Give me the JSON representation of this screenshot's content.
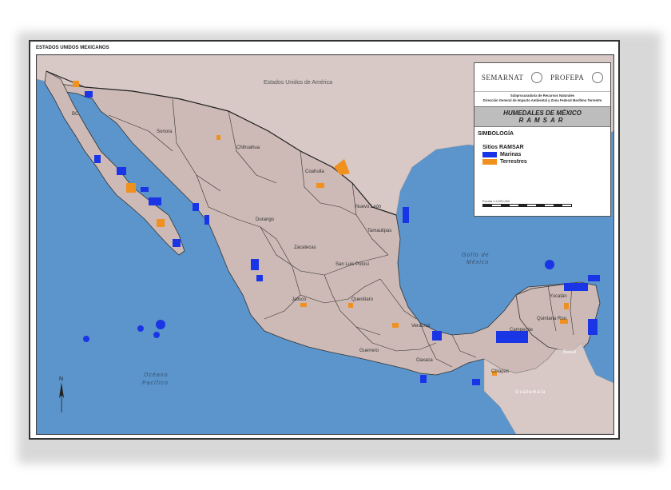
{
  "top_label": "ESTADOS UNIDOS MEXICANOS",
  "legend": {
    "logos": [
      "SEMARNAT",
      "PROFEPA"
    ],
    "subtitle_lines": [
      "Subprocuraduría de Recursos Naturales",
      "Dirección General de Impacto Ambiental y Zona Federal Marítimo Terrestre"
    ],
    "title_line1": "HUMEDALES DE MÉXICO",
    "title_line2": "RAMSAR",
    "simbologia": "SIMBOLOGÍA",
    "sitios": "Sitios RAMSAR",
    "items": [
      {
        "label": "Marinas",
        "color": "#1a35e6"
      },
      {
        "label": "Terrestres",
        "color": "#f0901e"
      }
    ],
    "scale": "Escala 1:4,000,000"
  },
  "labels": {
    "usa": "Estados Unidos de América",
    "gulf_line1": "Golfo de",
    "gulf_line2": "México",
    "pacific_line1": "Océano",
    "pacific_line2": "Pacífico",
    "belice": "Belice",
    "guatemala": "Guatemala",
    "north": "N",
    "states": {
      "bc": "BC",
      "sonora": "Sonora",
      "chihuahua": "Chihuahua",
      "coahuila": "Coahuila",
      "nuevo_leon": "Nuevo León",
      "tamaulipas": "Tamaulipas",
      "durango": "Durango",
      "zacatecas": "Zacatecas",
      "slp": "San Luis Potosí",
      "jalisco": "Jalisco",
      "queretaro": "Querétaro",
      "veracruz": "Veracruz",
      "guerrero": "Guerrero",
      "oaxaca": "Oaxaca",
      "chiapas": "Chiapas",
      "campeche": "Campeche",
      "yucatan": "Yucatán",
      "quintana_roo": "Quintana Roo"
    }
  },
  "colors": {
    "ocean": "#5b95cc",
    "land": "#cdbab6",
    "foreign_land": "#d8c9c6",
    "marine_site": "#1a35e6",
    "terrestrial_site": "#f0901e",
    "border": "#333333"
  }
}
